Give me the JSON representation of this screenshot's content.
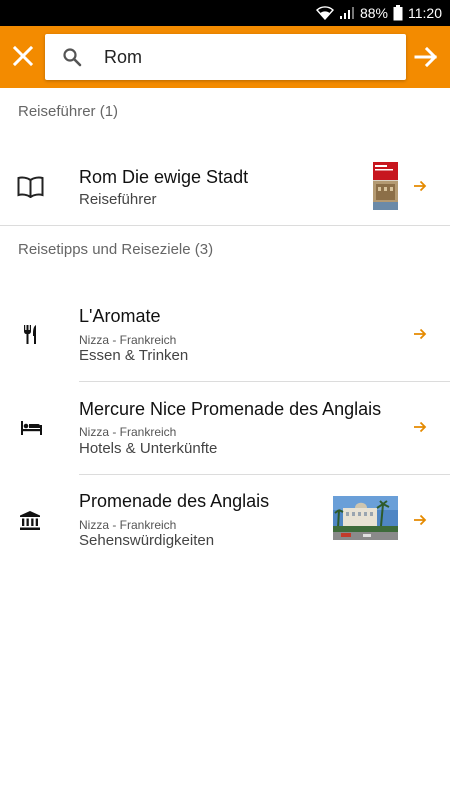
{
  "status_bar": {
    "battery": "88%",
    "time": "11:20"
  },
  "search": {
    "value": "Rom"
  },
  "sections": {
    "guides": {
      "header": "Reiseführer (1)"
    },
    "tips": {
      "header": "Reisetipps und Reiseziele (3)"
    }
  },
  "guide_item": {
    "title": "Rom Die ewige Stadt",
    "subtitle": "Reiseführer"
  },
  "results": [
    {
      "title": "L'Aromate",
      "location": "Nizza - Frankreich",
      "category": "Essen & Trinken",
      "icon": "restaurant-icon"
    },
    {
      "title": "Mercure Nice Promenade des Anglais",
      "location": "Nizza - Frankreich",
      "category": "Hotels & Unterkünfte",
      "icon": "bed-icon"
    },
    {
      "title": "Promenade des Anglais",
      "location": "Nizza - Frankreich",
      "category": "Sehenswürdigkeiten",
      "icon": "landmark-icon"
    }
  ],
  "colors": {
    "accent": "#f38b00",
    "arrow": "#e58a00"
  }
}
